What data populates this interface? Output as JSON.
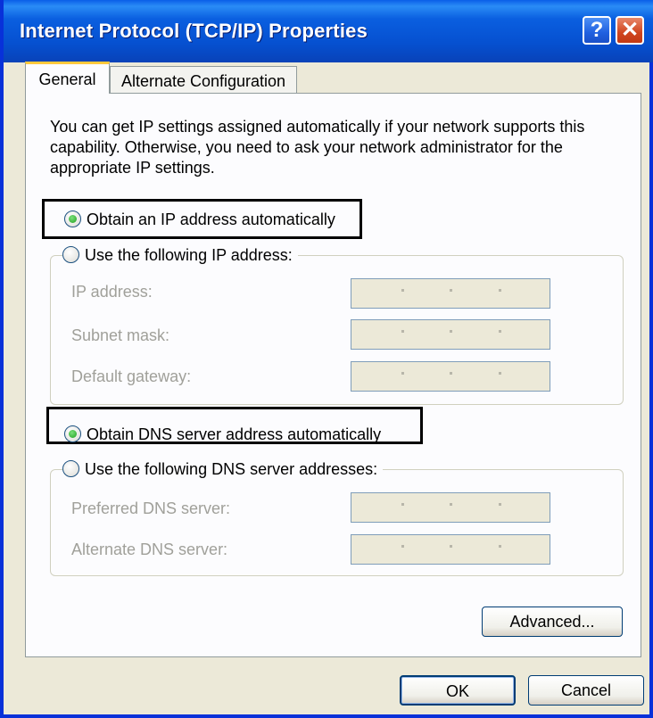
{
  "window": {
    "title": "Internet Protocol (TCP/IP) Properties",
    "help_glyph": "?",
    "close_glyph": "✕"
  },
  "tabs": [
    {
      "label": "General",
      "active": true
    },
    {
      "label": "Alternate Configuration",
      "active": false
    }
  ],
  "description": "You can get IP settings assigned automatically if your network supports this capability. Otherwise, you need to ask your network administrator for the appropriate IP settings.",
  "ip": {
    "auto_label": "Obtain an IP address automatically",
    "auto_selected": true,
    "manual_label": "Use the following IP address:",
    "fields": [
      {
        "label": "IP address:",
        "value": ""
      },
      {
        "label": "Subnet mask:",
        "value": ""
      },
      {
        "label": "Default gateway:",
        "value": ""
      }
    ]
  },
  "dns": {
    "auto_label": "Obtain DNS server address automatically",
    "auto_selected": true,
    "manual_label": "Use the following DNS server addresses:",
    "fields": [
      {
        "label": "Preferred DNS server:",
        "value": ""
      },
      {
        "label": "Alternate DNS server:",
        "value": ""
      }
    ]
  },
  "buttons": {
    "advanced": "Advanced...",
    "ok": "OK",
    "cancel": "Cancel"
  },
  "colors": {
    "titlebar": "#0a5fe0",
    "radio_selected": "#21a121",
    "dialog_bg": "#ece9d8"
  }
}
